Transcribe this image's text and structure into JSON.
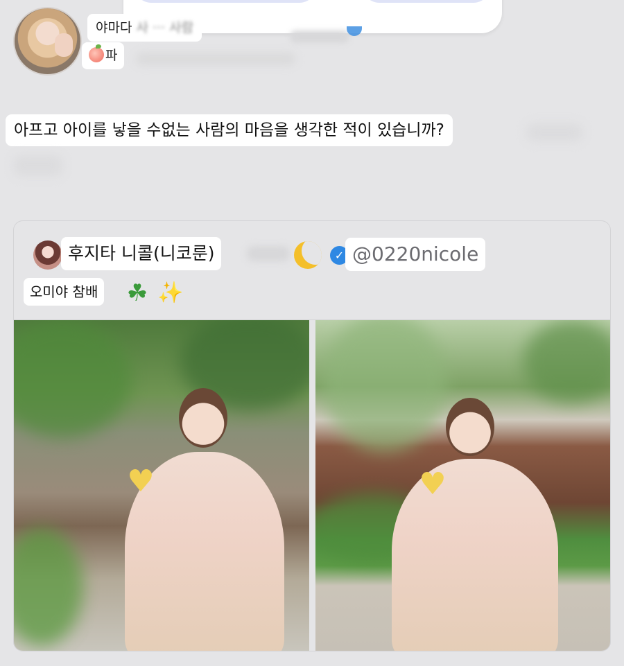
{
  "top_bar": {
    "left_pill_glyph": "↓"
  },
  "post": {
    "author_name": "야마다",
    "author_name_obscured": "사 ··· 사람",
    "peach_label": "파"
  },
  "question": {
    "text": "아프고 아이를 낳을 수없는 사람의 마음을 생각한 적이 있습니까?"
  },
  "quoted_post": {
    "display_name": "후지타 니콜(니코룬)",
    "handle": "@0220nicole",
    "caption": "오미야 참배",
    "icons": [
      "moon-icon",
      "verified-icon",
      "clover-icon",
      "sparkles-icon",
      "yellow-heart-icon"
    ],
    "verified_mark": "✓",
    "clover_glyph": "☘",
    "sparkle_glyph": "✨",
    "heart_glyph": "♥",
    "colors": {
      "verified_blue": "#2e88e3",
      "moon_yellow": "#f4bf2a",
      "heart_yellow": "#f2d052",
      "clover_green": "#3a9a3a"
    }
  }
}
